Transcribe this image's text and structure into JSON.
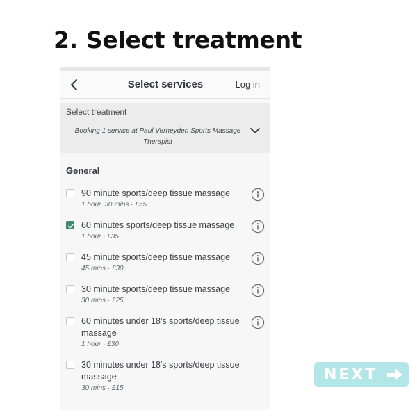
{
  "heading": {
    "step": "2.",
    "text": "Select treatment"
  },
  "nav": {
    "title": "Select services",
    "login_label": "Log in"
  },
  "selector": {
    "label": "Select treatment",
    "value": "Booking 1 service at Paul Verheyden Sports Massage Therapist"
  },
  "section": {
    "title": "General"
  },
  "services": [
    {
      "name": "90 minute sports/deep tissue massage",
      "meta": "1 hour, 30 mins · £55",
      "checked": false,
      "has_info": true
    },
    {
      "name": "60 minutes sports/deep tissue massage",
      "meta": "1 hour · £35",
      "checked": true,
      "has_info": true
    },
    {
      "name": "45 minute sports/deep tissue massage",
      "meta": "45 mins · £30",
      "checked": false,
      "has_info": true
    },
    {
      "name": "30 minute sports/deep tissue massage",
      "meta": "30 mins · £25",
      "checked": false,
      "has_info": true
    },
    {
      "name": "60 minutes under 18's sports/deep tissue massage",
      "meta": "1 hour · £30",
      "checked": false,
      "has_info": true
    },
    {
      "name": "30 minutes under 18's sports/deep tissue massage",
      "meta": "30 mins · £15",
      "checked": false,
      "has_info": false
    }
  ],
  "next_button": {
    "label": "NEXT",
    "icon": "arrow-right-icon"
  },
  "colors": {
    "accent_check": "#3f8a6f",
    "next_bg": "#b3e6e6"
  }
}
